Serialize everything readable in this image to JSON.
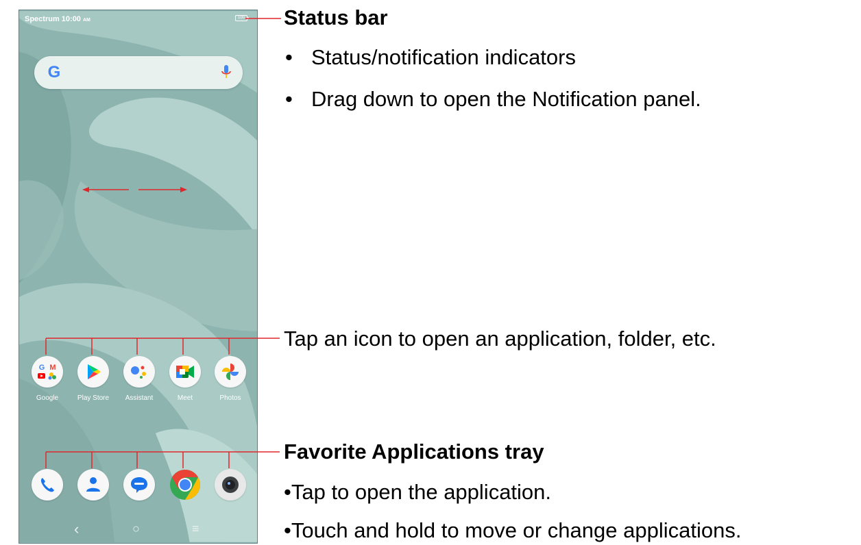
{
  "phone": {
    "status_bar": {
      "carrier": "Spectrum 10:00",
      "ampm": "AM",
      "battery": "100"
    },
    "search_bar": {
      "logo": "google-g-icon",
      "mic": "mic-icon"
    },
    "apps": [
      {
        "label": "Google",
        "icon": "google-folder-icon"
      },
      {
        "label": "Play Store",
        "icon": "play-store-icon"
      },
      {
        "label": "Assistant",
        "icon": "assistant-icon"
      },
      {
        "label": "Meet",
        "icon": "meet-icon"
      },
      {
        "label": "Photos",
        "icon": "photos-icon"
      }
    ],
    "dock": [
      {
        "icon": "phone-icon"
      },
      {
        "icon": "contacts-icon"
      },
      {
        "icon": "messages-icon"
      },
      {
        "icon": "chrome-icon"
      },
      {
        "icon": "camera-icon"
      }
    ],
    "navbar": {
      "back": "‹",
      "home": "○",
      "recents": "≡"
    }
  },
  "annotations": {
    "status_bar": {
      "title": "Status bar",
      "bullets": [
        "Status/notification indicators",
        "Drag down to open the Notification panel."
      ]
    },
    "apps_note": "Tap an icon to open an application, folder, etc.",
    "favorites": {
      "title": "Favorite Applications tray",
      "bullets": [
        "•Tap to open the application.",
        "•Touch and hold to move or change applications."
      ]
    }
  },
  "colors": {
    "annotation_line": "#e0262b",
    "wallpaper": "#8fb7b2"
  }
}
